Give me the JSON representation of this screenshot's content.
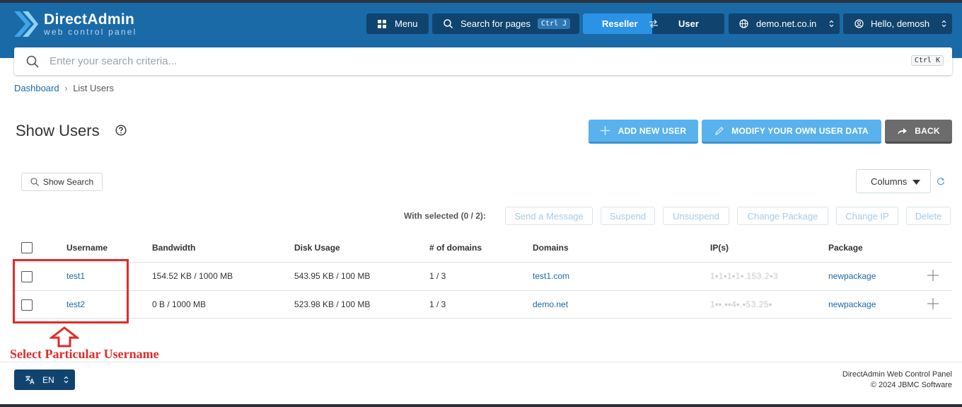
{
  "app": {
    "logo_title": "DirectAdmin",
    "logo_subtitle": "web control panel"
  },
  "topnav": {
    "menu_label": "Menu",
    "search_pages_label": "Search for pages",
    "search_pages_shortcut": "Ctrl J",
    "reseller_label": "Reseller",
    "user_label": "User",
    "domain_label": "demo.net.co.in",
    "greeting_label": "Hello, demosh"
  },
  "search": {
    "placeholder": "Enter your search criteria...",
    "shortcut": "Ctrl K"
  },
  "breadcrumb": {
    "root": "Dashboard",
    "separator": "›",
    "current": "List Users"
  },
  "page": {
    "title": "Show Users"
  },
  "actions": {
    "add_user": "ADD NEW USER",
    "modify_data": "MODIFY YOUR OWN USER DATA",
    "back": "BACK"
  },
  "toolbar": {
    "show_search": "Show Search",
    "columns": "Columns"
  },
  "bulk": {
    "with_selected": "With selected (0 / 2):",
    "send_message": "Send a Message",
    "suspend": "Suspend",
    "unsuspend": "Unsuspend",
    "change_package": "Change Package",
    "change_ip": "Change IP",
    "delete": "Delete"
  },
  "table": {
    "headers": {
      "username": "Username",
      "bandwidth": "Bandwidth",
      "disk_usage": "Disk Usage",
      "num_domains": "# of domains",
      "domains": "Domains",
      "ips": "IP(s)",
      "package": "Package"
    },
    "rows": [
      {
        "username": "test1",
        "bandwidth": "154.52 KB / 1000 MB",
        "disk_usage": "543.95 KB / 100 MB",
        "num_domains": "1 / 3",
        "domain": "test1.com",
        "ip": "1▪1▪1▪1▪.153.2▪3",
        "package": "newpackage"
      },
      {
        "username": "test2",
        "bandwidth": "0 B / 1000 MB",
        "disk_usage": "523.98 KB / 100 MB",
        "num_domains": "1 / 3",
        "domain": "demo.net",
        "ip": "1▪▪.▪▪4▪.▪53.25▪",
        "package": "newpackage"
      }
    ]
  },
  "annotation": {
    "text": "Select Particular Username"
  },
  "footer": {
    "language": "EN",
    "product": "DirectAdmin Web Control Panel",
    "copyright": "© 2024 JBMC Software"
  }
}
